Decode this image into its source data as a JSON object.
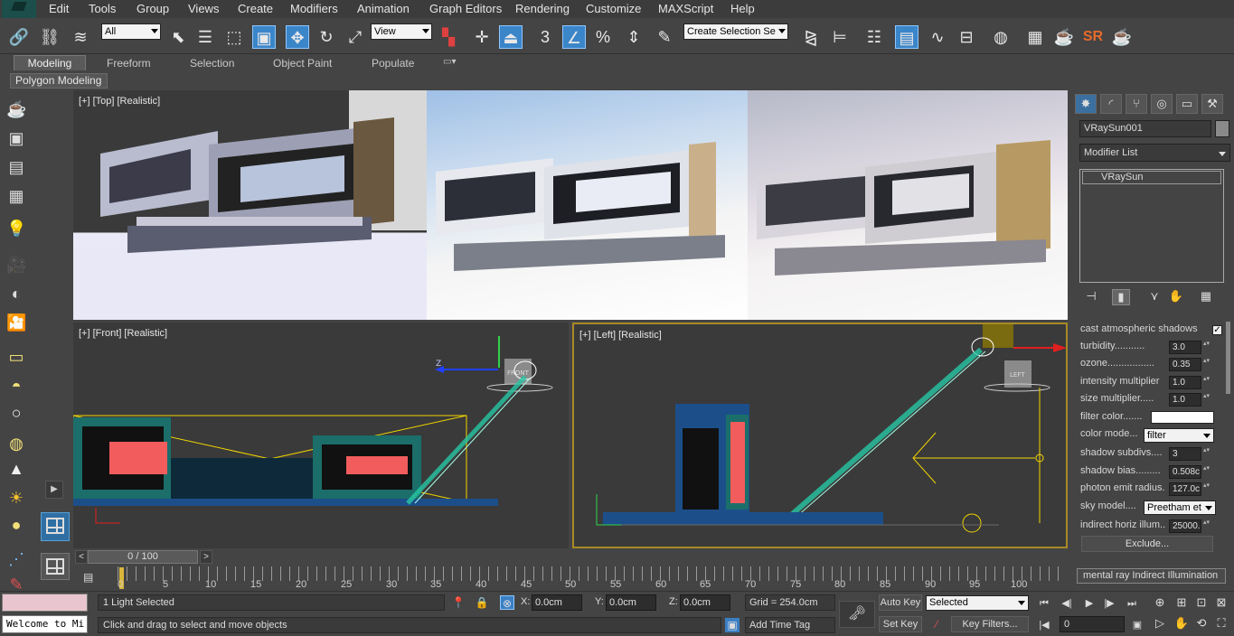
{
  "menu": [
    "Edit",
    "Tools",
    "Group",
    "Views",
    "Create",
    "Modifiers",
    "Animation",
    "Graph Editors",
    "Rendering",
    "Customize",
    "MAXScript",
    "Help"
  ],
  "toolbar": {
    "selection_filter": "All",
    "ref_coord": "View",
    "named_selection": "Create Selection Se",
    "snap_label": "3",
    "sr_label": "SR"
  },
  "ribbon": {
    "tabs": [
      "Modeling",
      "Freeform",
      "Selection",
      "Object Paint",
      "Populate"
    ],
    "active_tab": "Modeling",
    "sub_panel": "Polygon Modeling"
  },
  "viewports": {
    "top": "[+] [Top] [Realistic]",
    "front": "[+] [Front] [Realistic]",
    "left": "[+] [Left] [Realistic]"
  },
  "scene_labels": {
    "front_axis": "Z",
    "box_label": "FRONT",
    "left_box_label": "LEFT"
  },
  "command_panel": {
    "object_name": "VRaySun001",
    "modifier_list": "Modifier List",
    "stack_item": "VRaySun",
    "params": [
      {
        "label": "cast atmospheric shadows",
        "type": "check",
        "value": "✓"
      },
      {
        "label": "turbidity",
        "type": "spin",
        "value": "3.0"
      },
      {
        "label": "ozone",
        "type": "spin",
        "value": "0.35"
      },
      {
        "label": "intensity multiplier",
        "type": "spin",
        "value": "1.0"
      },
      {
        "label": "size multiplier",
        "type": "spin",
        "value": "1.0"
      },
      {
        "label": "filter color",
        "type": "color",
        "value": ""
      },
      {
        "label": "color mode",
        "type": "drop",
        "value": "filter"
      },
      {
        "label": "shadow subdivs",
        "type": "spin",
        "value": "3"
      },
      {
        "label": "shadow bias",
        "type": "spin",
        "value": "0.508c"
      },
      {
        "label": "photon emit radius",
        "type": "spin",
        "value": "127.0c"
      },
      {
        "label": "sky model",
        "type": "drop",
        "value": "Preetham et"
      },
      {
        "label": "indirect horiz illum",
        "type": "spin",
        "value": "25000."
      }
    ],
    "exclude_button": "Exclude...",
    "rollout": "mental ray Indirect Illumination"
  },
  "time": {
    "slider": "0 / 100",
    "ticks": [
      "0",
      "5",
      "10",
      "15",
      "20",
      "25",
      "30",
      "35",
      "40",
      "45",
      "50",
      "55",
      "60",
      "65",
      "70",
      "75",
      "80",
      "85",
      "90",
      "95",
      "100"
    ]
  },
  "status": {
    "listener": "Welcome to Mi",
    "selection": "1 Light Selected",
    "prompt": "Click and drag to select and move objects",
    "x_label": "X:",
    "x_value": "0.0cm",
    "y_label": "Y:",
    "y_value": "0.0cm",
    "z_label": "Z:",
    "z_value": "0.0cm",
    "grid": "Grid = 254.0cm",
    "add_time_tag": "Add Time Tag",
    "auto_key": "Auto Key",
    "set_key": "Set Key",
    "key_mode": "Selected",
    "key_filters": "Key Filters...",
    "frame": "0"
  }
}
